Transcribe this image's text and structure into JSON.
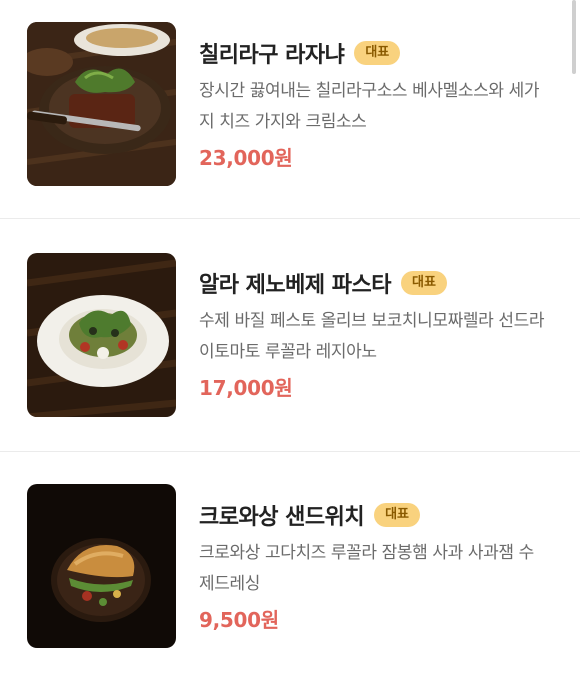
{
  "menu": {
    "items": [
      {
        "title": "칠리라구 라자냐",
        "badge": "대표",
        "description": "장시간 끓여내는 칠리라구소스 베사멜소스와 세가지 치즈 가지와 크림소스",
        "price": "23,000원",
        "image_icon": "lasagna-dish-photo"
      },
      {
        "title": "알라 제노베제 파스타",
        "badge": "대표",
        "description": "수제 바질 페스토 올리브 보코치니모짜렐라 선드라이토마토 루꼴라 레지아노",
        "price": "17,000원",
        "image_icon": "pasta-dish-photo"
      },
      {
        "title": "크로와상 샌드위치",
        "badge": "대표",
        "description": "크로와상 고다치즈 루꼴라 잠봉햄 사과 사과잼 수제드레싱",
        "price": "9,500원",
        "image_icon": "croissant-sandwich-photo"
      }
    ]
  },
  "colors": {
    "price": "#e2655b",
    "badge_bg": "#f9d27e",
    "title": "#222222",
    "description": "#6b6b6b"
  }
}
